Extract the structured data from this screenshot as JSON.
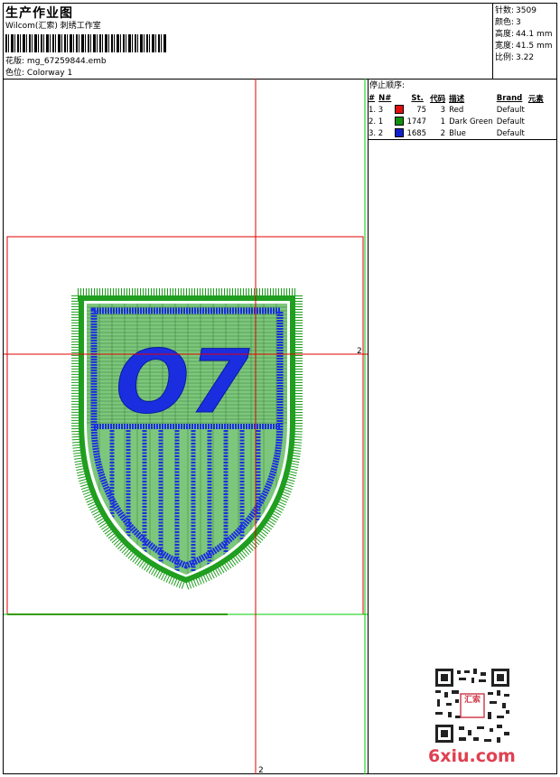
{
  "header": {
    "title": "生产作业图",
    "studio": "Wilcom(汇索) 刺绣工作室",
    "design_label": "花版:",
    "design_value": "mg_67259844.emb",
    "colorway_label": "色位:",
    "colorway_value": "Colorway 1"
  },
  "stats": [
    {
      "label": "针数:",
      "value": "3509"
    },
    {
      "label": "颜色:",
      "value": "3"
    },
    {
      "label": "高度:",
      "value": "44.1 mm"
    },
    {
      "label": "宽度:",
      "value": "41.5 mm"
    },
    {
      "label": "比例:",
      "value": "3.22"
    }
  ],
  "stop_sequence": {
    "title": "停止顺序:",
    "columns": [
      "#",
      "N#",
      "St.",
      "代码",
      "描述",
      "Brand",
      "元素"
    ],
    "rows": [
      {
        "seq": "1. 3",
        "stitches": "75",
        "code": "3",
        "desc": "Red",
        "brand": "Default",
        "color": "#e01010"
      },
      {
        "seq": "2. 1",
        "stitches": "1747",
        "code": "1",
        "desc": "Dark Green",
        "brand": "Default",
        "color": "#109010"
      },
      {
        "seq": "3. 2",
        "stitches": "1685",
        "code": "2",
        "desc": "Blue",
        "brand": "Default",
        "color": "#1020d0"
      }
    ]
  },
  "design": {
    "letters": "O7",
    "guide_marker_right": "2",
    "guide_marker_bottom": "2"
  },
  "watermark": {
    "text": "6xiu.com",
    "seal_text": "汇索"
  },
  "colors": {
    "guide_red": "#e00000",
    "guide_green": "#00cc00",
    "fill_green": "#7cc77c",
    "stitch_blue": "#1a2ee0",
    "stitch_green": "#1f9e1f",
    "watermark": "#e04050"
  }
}
